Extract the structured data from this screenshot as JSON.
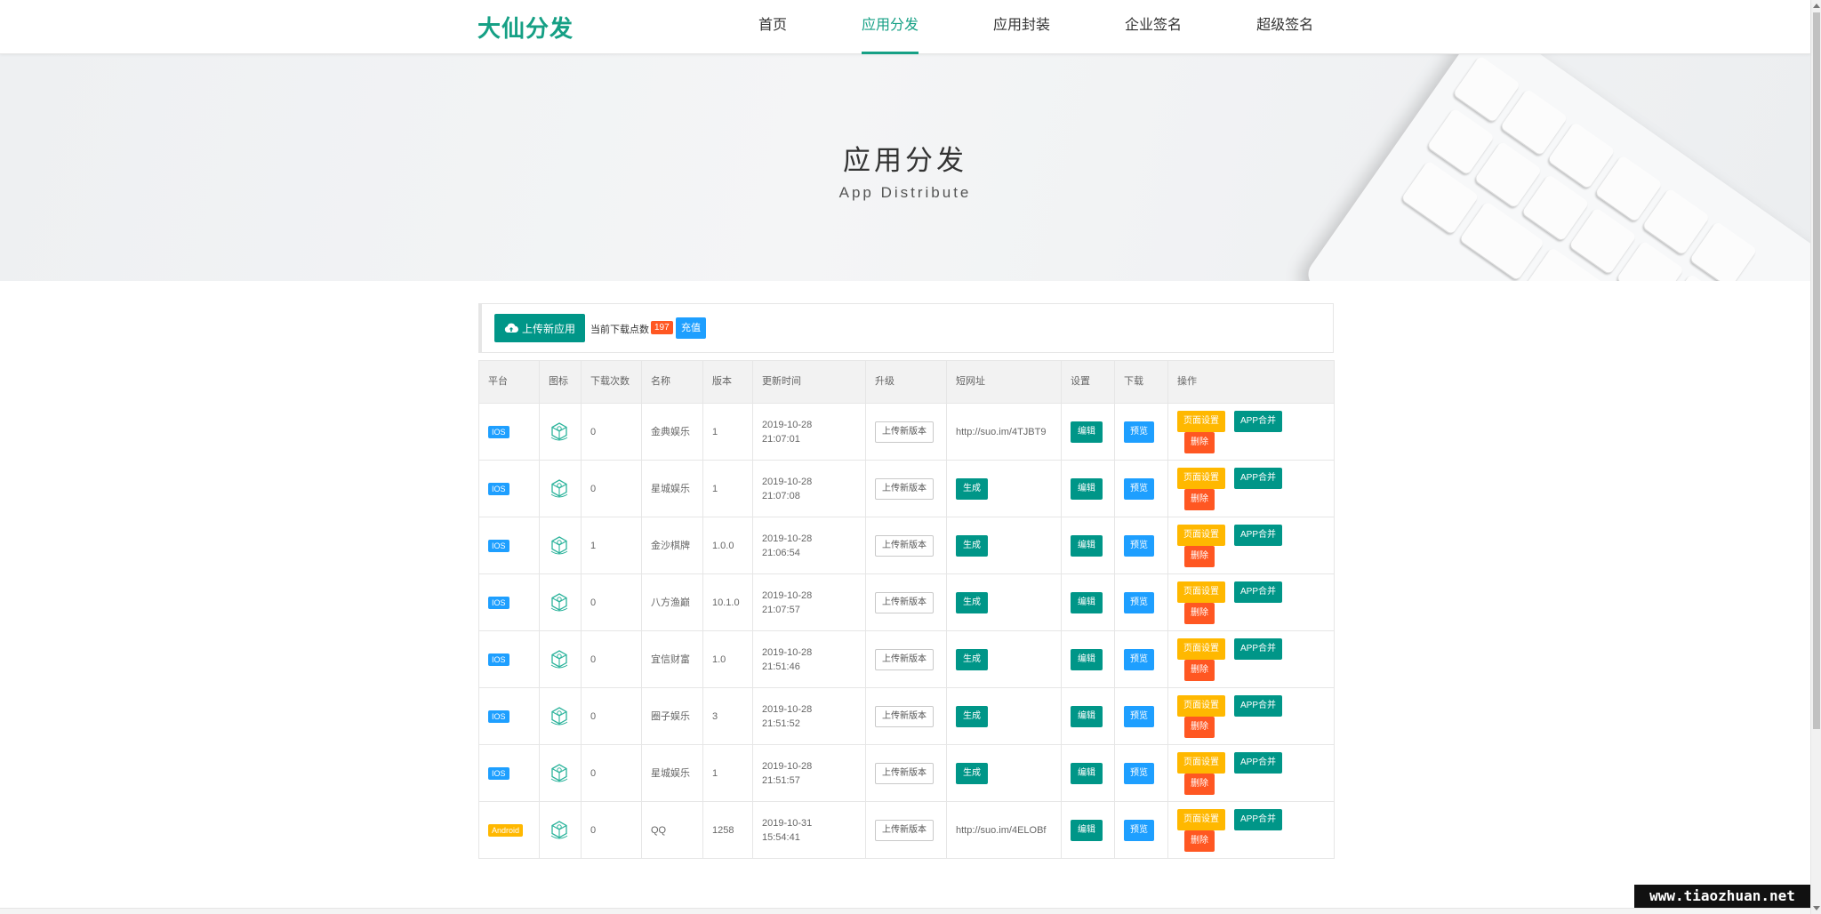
{
  "header": {
    "logo": "大仙分发",
    "nav": [
      "首页",
      "应用分发",
      "应用封装",
      "企业签名",
      "超级签名"
    ],
    "active_nav": "应用分发"
  },
  "banner": {
    "title": "应用分发",
    "subtitle": "App Distribute"
  },
  "toolbar": {
    "upload_label": "上传新应用",
    "points_label": "当前下载点数",
    "points": "197",
    "recharge_label": "充值"
  },
  "table": {
    "headers": [
      "平台",
      "图标",
      "下载次数",
      "名称",
      "版本",
      "更新时间",
      "升级",
      "短网址",
      "设置",
      "下载",
      "操作"
    ],
    "upgrade_label": "上传新版本",
    "generate_label": "生成",
    "edit_label": "编辑",
    "preview_label": "预览",
    "page_settings_label": "页面设置",
    "merge_label": "APP合并",
    "delete_label": "删除",
    "rows": [
      {
        "platform": "IOS",
        "downloads": "0",
        "name": "金典娱乐",
        "version": "1",
        "date": "2019-10-28",
        "time": "21:07:01",
        "short_url": "http://suo.im/4TJBT9"
      },
      {
        "platform": "IOS",
        "downloads": "0",
        "name": "星城娱乐",
        "version": "1",
        "date": "2019-10-28",
        "time": "21:07:08",
        "short_url": ""
      },
      {
        "platform": "IOS",
        "downloads": "1",
        "name": "金沙棋牌",
        "version": "1.0.0",
        "date": "2019-10-28",
        "time": "21:06:54",
        "short_url": ""
      },
      {
        "platform": "IOS",
        "downloads": "0",
        "name": "八方渔巅",
        "version": "10.1.0",
        "date": "2019-10-28",
        "time": "21:07:57",
        "short_url": ""
      },
      {
        "platform": "IOS",
        "downloads": "0",
        "name": "宜信财富",
        "version": "1.0",
        "date": "2019-10-28",
        "time": "21:51:46",
        "short_url": ""
      },
      {
        "platform": "IOS",
        "downloads": "0",
        "name": "圈子娱乐",
        "version": "3",
        "date": "2019-10-28",
        "time": "21:51:52",
        "short_url": ""
      },
      {
        "platform": "IOS",
        "downloads": "0",
        "name": "星城娱乐",
        "version": "1",
        "date": "2019-10-28",
        "time": "21:51:57",
        "short_url": ""
      },
      {
        "platform": "Android",
        "downloads": "0",
        "name": "QQ",
        "version": "1258",
        "date": "2019-10-31",
        "time": "15:54:41",
        "short_url": "http://suo.im/4ELOBf"
      }
    ]
  },
  "icons": {
    "upload": "cloud-upload-icon",
    "app": "app-placeholder-icon"
  },
  "colors": {
    "brand": "#16a085",
    "primary_green": "#009688",
    "blue": "#1e9fff",
    "orange": "#ffb800",
    "red": "#ff5722"
  },
  "watermark": "www.tiaozhuan.net"
}
